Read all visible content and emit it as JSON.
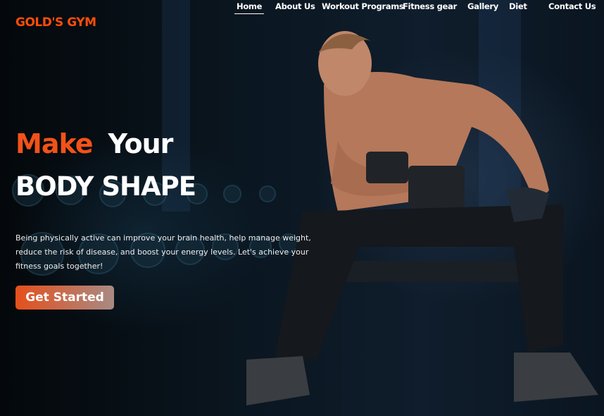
{
  "brand": {
    "logo": "GOLD'S GYM",
    "accent": "#f25219"
  },
  "nav": {
    "items": [
      {
        "label": "Home",
        "active": true
      },
      {
        "label": "About Us"
      },
      {
        "label": "Workout Programs"
      },
      {
        "label": "Fitness gear"
      },
      {
        "label": "Gallery"
      },
      {
        "label": "Diet"
      },
      {
        "label": "Contact Us"
      }
    ]
  },
  "hero": {
    "word1": "Make",
    "word2": "Your",
    "line2": "BODY SHAPE",
    "description": "Being physically active can improve your brain health, help manage weight, reduce the risk of disease, and boost your energy levels. Let's achieve your fitness goals together!",
    "cta": "Get Started"
  }
}
